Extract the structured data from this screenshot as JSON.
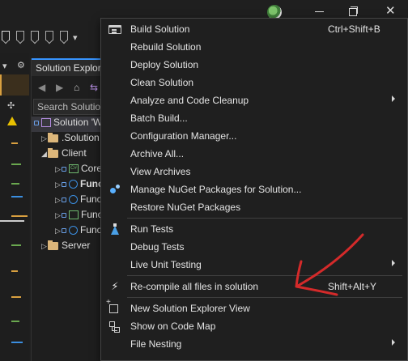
{
  "explorer": {
    "tab_title": "Solution Explorer",
    "search_placeholder": "Search Solution Explorer",
    "tree": [
      {
        "label": "Solution 'Web'"
      },
      {
        "label": ".Solution Items"
      },
      {
        "label": "Client"
      },
      {
        "label": "Core"
      },
      {
        "label": "Functions"
      },
      {
        "label": "Functions"
      },
      {
        "label": "Functions"
      },
      {
        "label": "Functions"
      },
      {
        "label": "Server"
      }
    ]
  },
  "context_menu": {
    "items": [
      {
        "label": "Build Solution",
        "shortcut": "Ctrl+Shift+B",
        "icon": "build-icon"
      },
      {
        "label": "Rebuild Solution"
      },
      {
        "label": "Deploy Solution"
      },
      {
        "label": "Clean Solution"
      },
      {
        "label": "Analyze and Code Cleanup",
        "submenu": true
      },
      {
        "label": "Batch Build..."
      },
      {
        "label": "Configuration Manager..."
      },
      {
        "label": "Archive All..."
      },
      {
        "label": "View Archives"
      },
      {
        "label": "Manage NuGet Packages for Solution...",
        "icon": "nuget-icon"
      },
      {
        "label": "Restore NuGet Packages"
      },
      {
        "label": "Run Tests",
        "icon": "flask-icon"
      },
      {
        "label": "Debug Tests"
      },
      {
        "label": "Live Unit Testing",
        "submenu": true
      },
      {
        "label": "Re-compile all files in solution",
        "shortcut": "Shift+Alt+Y",
        "icon": "lightning-icon"
      },
      {
        "label": "New Solution Explorer View",
        "icon": "new-view-icon"
      },
      {
        "label": "Show on Code Map",
        "icon": "code-map-icon"
      },
      {
        "label": "File Nesting",
        "submenu": true
      }
    ]
  },
  "colors": {
    "menu_background": "#1f1f1f",
    "annotation_arrow": "#d42a2a"
  }
}
